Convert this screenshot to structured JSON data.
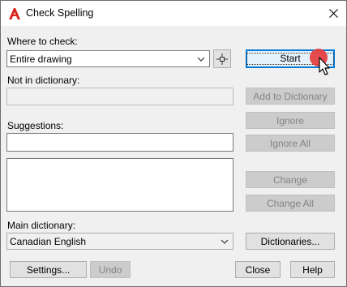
{
  "window": {
    "title": "Check Spelling"
  },
  "where_to_check": {
    "label": "Where to check:",
    "value": "Entire drawing"
  },
  "not_in_dictionary": {
    "label": "Not in dictionary:",
    "value": ""
  },
  "suggestions": {
    "label": "Suggestions:",
    "value": ""
  },
  "main_dictionary": {
    "label": "Main dictionary:",
    "value": "Canadian English"
  },
  "buttons": {
    "start": "Start",
    "add_to_dictionary": "Add to Dictionary",
    "ignore": "Ignore",
    "ignore_all": "Ignore All",
    "change": "Change",
    "change_all": "Change All",
    "dictionaries": "Dictionaries...",
    "settings": "Settings...",
    "undo": "Undo",
    "close": "Close",
    "help": "Help"
  },
  "icons": {
    "app": "autocad-a-icon",
    "close": "close-icon",
    "select_objects": "crosshair-select-icon",
    "cursor": "mouse-pointer-icon"
  },
  "colors": {
    "accent": "#0078d7",
    "app_icon": "#d9241c",
    "click_indicator": "#e5383b"
  }
}
